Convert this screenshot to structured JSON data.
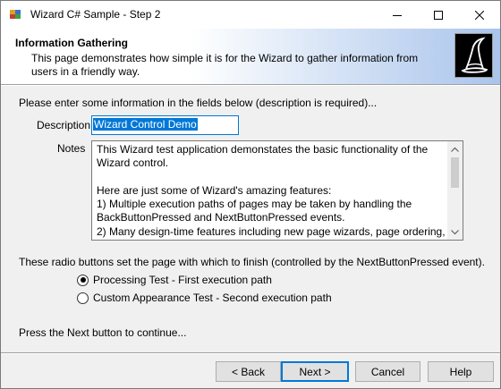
{
  "window": {
    "title": "Wizard C# Sample - Step 2",
    "controls": {
      "minimize_icon": "minimize-icon",
      "maximize_icon": "maximize-icon",
      "close_icon": "close-icon"
    }
  },
  "banner": {
    "title": "Information Gathering",
    "description": "This page demonstrates how simple it is for the Wizard to gather information from users in a friendly way.",
    "logo_icon": "wizard-hat-icon"
  },
  "form": {
    "intro": "Please enter some information in the fields below (description is required)...",
    "description_label": "Description",
    "description_value": "Wizard Control Demo",
    "notes_label": "Notes",
    "notes_value": "This Wizard test application demonstates the basic functionality of the Wizard control.\n\nHere are just some of Wizard's amazing features:\n1) Multiple execution paths of pages may be taken by handling the BackButtonPressed and NextButtonPressed events.\n2) Many design-time features including new page wizards, page ordering, and support for localization."
  },
  "radio_section": {
    "prompt": "These radio buttons set the page with which to finish (controlled by the NextButtonPressed event).",
    "options": [
      {
        "label": "Processing Test - First execution path",
        "checked": true
      },
      {
        "label": "Custom Appearance Test - Second execution path",
        "checked": false
      }
    ]
  },
  "footer_text": "Press the Next button to continue...",
  "buttons": {
    "back": "< Back",
    "next": "Next >",
    "cancel": "Cancel",
    "help": "Help"
  },
  "colors": {
    "accent": "#0078d7",
    "banner_gradient_end": "#a9c4ec",
    "window_bg": "#f0f0f0"
  }
}
